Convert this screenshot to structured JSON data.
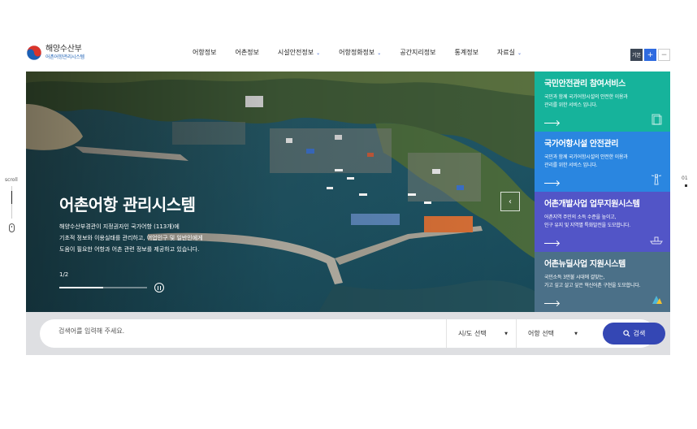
{
  "header": {
    "logo_top": "해양수산부",
    "logo_bottom": "어촌어항관리시스템",
    "nav": [
      {
        "label": "어항정보",
        "dropdown": false
      },
      {
        "label": "어촌정보",
        "dropdown": false
      },
      {
        "label": "시설안전정보",
        "dropdown": true
      },
      {
        "label": "어항정화정보",
        "dropdown": true
      },
      {
        "label": "공간지리정보",
        "dropdown": false
      },
      {
        "label": "통계정보",
        "dropdown": false
      },
      {
        "label": "자료실",
        "dropdown": true
      }
    ],
    "font_controls": {
      "default": "기본",
      "plus": "+",
      "minus": "−"
    }
  },
  "hero": {
    "title": "어촌어항 관리시스템",
    "desc_lines": [
      "해양수산부경관이 지정권자인 국가어항 (113개)에",
      "기초적 정보와 이용실태를 관리하고, 어업인구 및 일반인에게",
      "도움이 필요한 어항과 어촌 관련 정보를 제공하고 있습니다."
    ],
    "pager": "1/2",
    "progress": 0.5,
    "prev_arrow": "‹"
  },
  "services": [
    {
      "title": "국민안전관리 참여서비스",
      "desc1": "국민과 함께 국가어항시설의 안전한 이용과",
      "desc2": "관리를 위한 서비스 입니다.",
      "color": "#16b39b",
      "icon": "document-icon"
    },
    {
      "title": "국가어항시설 안전관리",
      "desc1": "국민과 함께 국가어항시설의 안전한 이용과",
      "desc2": "관리를 위한 서비스 입니다.",
      "color": "#2a86e0",
      "icon": "lighthouse-icon"
    },
    {
      "title": "어촌개발사업 업무지원시스템",
      "desc1": "어촌지역 주민의 소득 수준을 높이고,",
      "desc2": "인구 유지 및 지역별 특화발전을 도모합니다.",
      "color": "#5255c7",
      "icon": "boat-icon"
    },
    {
      "title": "어촌뉴딜사업 지원시스템",
      "desc1": "국민소득 3만불 시대에 걸맞는,",
      "desc2": "가고 싶고 살고 싶은 혁신어촌 구현을 도모합니다.",
      "color": "#4b7088",
      "icon": "leaf-icon"
    }
  ],
  "search": {
    "placeholder": "검색어를 입력해 주세요.",
    "select1": "시/도 선택",
    "select2": "어항 선택",
    "button": "검색"
  },
  "side": {
    "scroll_label": "scroll",
    "right_num": "01"
  }
}
